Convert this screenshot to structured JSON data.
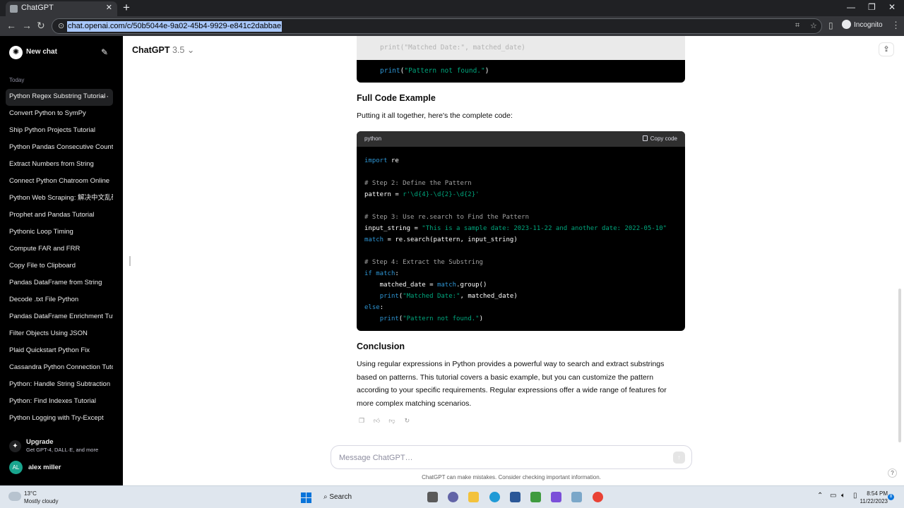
{
  "browser": {
    "tab_title": "ChatGPT",
    "url": "chat.openai.com/c/50b5044e-9a02-45b4-9929-e841c2dabbae",
    "incognito_label": "Incognito"
  },
  "sidebar": {
    "new_chat": "New chat",
    "section": "Today",
    "items": [
      "Python Regex Substring Tutorial",
      "Convert Python to SymPy",
      "Ship Python Projects Tutorial",
      "Python Pandas Consecutive Count",
      "Extract Numbers from String",
      "Connect Python Chatroom Online",
      "Python Web Scraping: 解决中文乱码",
      "Prophet and Pandas Tutorial",
      "Pythonic Loop Timing",
      "Compute FAR and FRR",
      "Copy File to Clipboard",
      "Pandas DataFrame from String",
      "Decode .txt File Python",
      "Pandas DataFrame Enrichment Tutorial",
      "Filter Objects Using JSON",
      "Plaid Quickstart Python Fix",
      "Cassandra Python Connection Tutorial",
      "Python: Handle String Subtraction",
      "Python: Find Indexes Tutorial",
      "Python Logging with Try-Except"
    ],
    "upgrade_title": "Upgrade",
    "upgrade_sub": "Get GPT-4, DALL·E, and more",
    "user_initials": "AL",
    "user_name": "alex miller"
  },
  "header": {
    "model": "ChatGPT",
    "version": "3.5"
  },
  "content": {
    "prev_code_line": "print(\"Pattern not found.\")",
    "prev_code_ghost": "print(\"Matched Date:\", matched_date)",
    "h_full": "Full Code Example",
    "p_full": "Putting it all together, here's the complete code:",
    "code_lang": "python",
    "copy_label": "Copy code",
    "h_conclusion": "Conclusion",
    "p_conclusion": "Using regular expressions in Python provides a powerful way to search and extract substrings based on patterns. This tutorial covers a basic example, but you can customize the pattern according to your specific requirements. Regular expressions offer a wide range of features for more complex matching scenarios."
  },
  "composer": {
    "placeholder": "Message ChatGPT…",
    "disclaimer": "ChatGPT can make mistakes. Consider checking important information."
  },
  "taskbar": {
    "temp": "13°C",
    "condition": "Mostly cloudy",
    "search": "Search",
    "time": "8:54 PM",
    "date": "11/22/2023",
    "notifications": "8"
  },
  "colors": {
    "sidebar_bg": "#000000",
    "code_keyword": "#2e95d3",
    "code_string": "#00a67d",
    "code_comment": "#a0a0a0"
  }
}
